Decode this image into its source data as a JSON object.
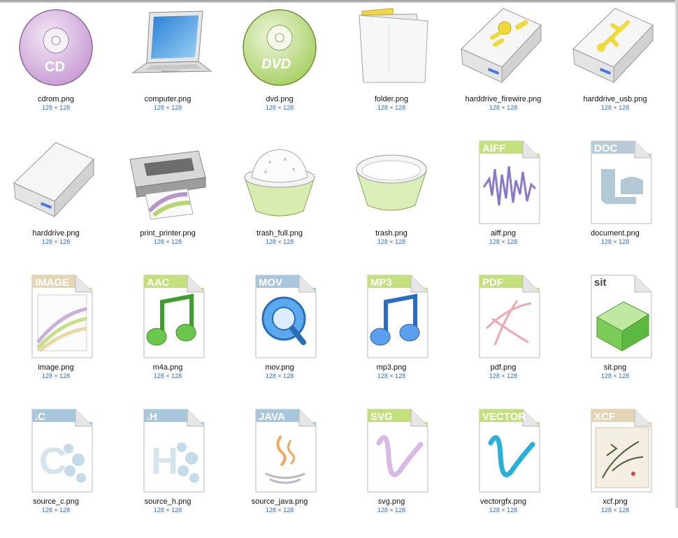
{
  "colors": {
    "background": "#ffffff",
    "filename_text": "#111111",
    "dimension_text": "#3a6fb3"
  },
  "files": [
    {
      "name": "cdrom.png",
      "dims": "128 × 128",
      "icon": "cd-disc-icon",
      "tag": "CD"
    },
    {
      "name": "computer.png",
      "dims": "128 × 128",
      "icon": "laptop-icon"
    },
    {
      "name": "dvd.png",
      "dims": "128 × 128",
      "icon": "dvd-disc-icon",
      "tag": "DVD"
    },
    {
      "name": "folder.png",
      "dims": "128 × 128",
      "icon": "folder-icon"
    },
    {
      "name": "harddrive_firewire.png",
      "dims": "128 × 128",
      "icon": "firewire-drive-icon"
    },
    {
      "name": "harddrive_usb.png",
      "dims": "128 × 128",
      "icon": "usb-drive-icon"
    },
    {
      "name": "harddrive.png",
      "dims": "128 × 128",
      "icon": "harddrive-icon"
    },
    {
      "name": "print_printer.png",
      "dims": "128 × 128",
      "icon": "printer-icon"
    },
    {
      "name": "trash_full.png",
      "dims": "128 × 128",
      "icon": "trash-full-icon"
    },
    {
      "name": "trash.png",
      "dims": "128 × 128",
      "icon": "trash-empty-icon"
    },
    {
      "name": "aiff.png",
      "dims": "128 × 128",
      "icon": "aiff-file-icon",
      "tag": "AIFF"
    },
    {
      "name": "document.png",
      "dims": "128 × 128",
      "icon": "document-file-icon",
      "tag": "DOC"
    },
    {
      "name": "image.png",
      "dims": "128 × 128",
      "icon": "image-file-icon",
      "tag": "IMAGE"
    },
    {
      "name": "m4a.png",
      "dims": "128 × 128",
      "icon": "m4a-file-icon",
      "tag": "AAC"
    },
    {
      "name": "mov.png",
      "dims": "128 × 128",
      "icon": "mov-file-icon",
      "tag": "MOV"
    },
    {
      "name": "mp3.png",
      "dims": "128 × 128",
      "icon": "mp3-file-icon",
      "tag": "MP3"
    },
    {
      "name": "pdf.png",
      "dims": "128 × 128",
      "icon": "pdf-file-icon",
      "tag": "PDF"
    },
    {
      "name": "sit.png",
      "dims": "128 × 128",
      "icon": "sit-archive-icon",
      "tag": "sit"
    },
    {
      "name": "source_c.png",
      "dims": "128 × 128",
      "icon": "source-c-file-icon",
      "tag": ".C",
      "letter": "C"
    },
    {
      "name": "source_h.png",
      "dims": "128 × 128",
      "icon": "source-h-file-icon",
      "tag": ".H",
      "letter": "H"
    },
    {
      "name": "source_java.png",
      "dims": "128 × 128",
      "icon": "source-java-file-icon",
      "tag": "JAVA"
    },
    {
      "name": "svg.png",
      "dims": "128 × 128",
      "icon": "svg-file-icon",
      "tag": "SVG"
    },
    {
      "name": "vectorgfx.png",
      "dims": "128 × 128",
      "icon": "vector-file-icon",
      "tag": "VECTOR"
    },
    {
      "name": "xcf.png",
      "dims": "128 × 128",
      "icon": "xcf-file-icon",
      "tag": "XCF"
    }
  ]
}
